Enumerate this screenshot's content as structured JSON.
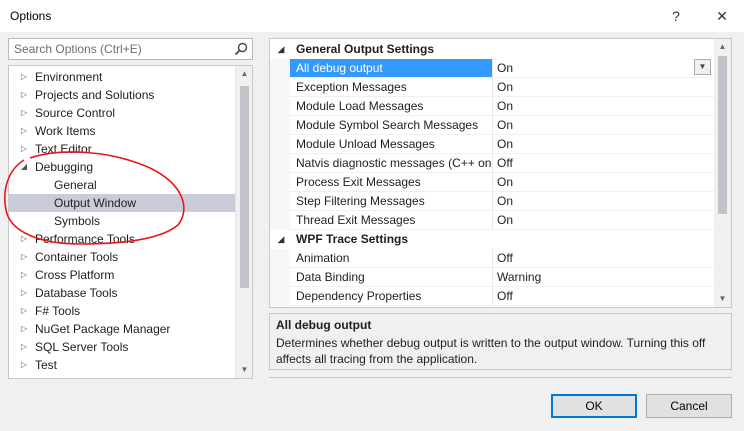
{
  "window": {
    "title": "Options",
    "help_glyph": "?",
    "close_glyph": "✕"
  },
  "search": {
    "placeholder": "Search Options (Ctrl+E)",
    "value": ""
  },
  "tree": {
    "items": [
      {
        "label": "Environment",
        "level": 0,
        "expanded": false
      },
      {
        "label": "Projects and Solutions",
        "level": 0,
        "expanded": false
      },
      {
        "label": "Source Control",
        "level": 0,
        "expanded": false
      },
      {
        "label": "Work Items",
        "level": 0,
        "expanded": false
      },
      {
        "label": "Text Editor",
        "level": 0,
        "expanded": false
      },
      {
        "label": "Debugging",
        "level": 0,
        "expanded": true
      },
      {
        "label": "General",
        "level": 1
      },
      {
        "label": "Output Window",
        "level": 1,
        "selected": true
      },
      {
        "label": "Symbols",
        "level": 1
      },
      {
        "label": "Performance Tools",
        "level": 0,
        "expanded": false
      },
      {
        "label": "Container Tools",
        "level": 0,
        "expanded": false
      },
      {
        "label": "Cross Platform",
        "level": 0,
        "expanded": false
      },
      {
        "label": "Database Tools",
        "level": 0,
        "expanded": false
      },
      {
        "label": "F# Tools",
        "level": 0,
        "expanded": false
      },
      {
        "label": "NuGet Package Manager",
        "level": 0,
        "expanded": false
      },
      {
        "label": "SQL Server Tools",
        "level": 0,
        "expanded": false
      },
      {
        "label": "Test",
        "level": 0,
        "expanded": false
      }
    ]
  },
  "grid": {
    "categories": [
      {
        "label": "General Output Settings",
        "rows": [
          {
            "name": "All debug output",
            "value": "On",
            "selected": true
          },
          {
            "name": "Exception Messages",
            "value": "On"
          },
          {
            "name": "Module Load Messages",
            "value": "On"
          },
          {
            "name": "Module Symbol Search Messages",
            "value": "On"
          },
          {
            "name": "Module Unload Messages",
            "value": "On"
          },
          {
            "name": "Natvis diagnostic messages (C++ only)",
            "value": "Off"
          },
          {
            "name": "Process Exit Messages",
            "value": "On"
          },
          {
            "name": "Step Filtering Messages",
            "value": "On"
          },
          {
            "name": "Thread Exit Messages",
            "value": "On"
          }
        ]
      },
      {
        "label": "WPF Trace Settings",
        "rows": [
          {
            "name": "Animation",
            "value": "Off"
          },
          {
            "name": "Data Binding",
            "value": "Warning"
          },
          {
            "name": "Dependency Properties",
            "value": "Off"
          }
        ]
      }
    ]
  },
  "description": {
    "title": "All debug output",
    "text": "Determines whether debug output is written to the output window. Turning this off affects all tracing from the application."
  },
  "buttons": {
    "ok": "OK",
    "cancel": "Cancel"
  },
  "colors": {
    "selection_accent": "#3399ff",
    "tree_selection": "#c9cbd8",
    "annotation_circle": "#e8161b"
  }
}
